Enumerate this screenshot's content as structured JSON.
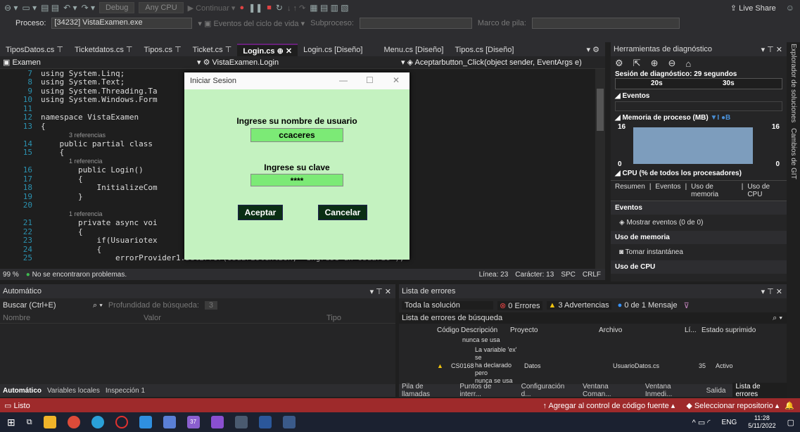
{
  "toolbar": {
    "debug": "Debug",
    "cpu": "Any CPU",
    "continue": "Continuar",
    "live_share": "Live Share"
  },
  "procbar": {
    "label": "Proceso:",
    "process": "[34232] VistaExamen.exe",
    "events": "Eventos del ciclo de vida",
    "subprocess": "Subproceso:",
    "frame": "Marco de pila:"
  },
  "tabs": [
    "TiposDatos.cs",
    "Ticketdatos.cs",
    "Tipos.cs",
    "Ticket.cs",
    "Login.cs",
    "Login.cs [Diseño]",
    "Menu.cs [Diseño]",
    "Tipos.cs [Diseño]"
  ],
  "active_tab": "Login.cs",
  "nav": {
    "project": "Examen",
    "class": "VistaExamen.Login",
    "member": "Aceptarbutton_Click(object sender, EventArgs e)"
  },
  "code": [
    {
      "n": "7",
      "t": "using System.Linq;"
    },
    {
      "n": "8",
      "t": "using System.Text;"
    },
    {
      "n": "9",
      "t": "using System.Threading.Ta"
    },
    {
      "n": "10",
      "t": "using System.Windows.Form"
    },
    {
      "n": "11",
      "t": ""
    },
    {
      "n": "12",
      "t": "namespace VistaExamen"
    },
    {
      "n": "13",
      "t": "{"
    },
    {
      "n": "",
      "t": "3 referencias",
      "ref": true
    },
    {
      "n": "14",
      "t": "    public partial class"
    },
    {
      "n": "15",
      "t": "    {"
    },
    {
      "n": "",
      "t": "1 referencia",
      "ref": true
    },
    {
      "n": "16",
      "t": "        public Login()"
    },
    {
      "n": "17",
      "t": "        {"
    },
    {
      "n": "18",
      "t": "            InitializeCom"
    },
    {
      "n": "19",
      "t": "        }"
    },
    {
      "n": "20",
      "t": ""
    },
    {
      "n": "",
      "t": "1 referencia",
      "ref": true
    },
    {
      "n": "21",
      "t": "        private async voi"
    },
    {
      "n": "22",
      "t": "        {"
    },
    {
      "n": "23",
      "t": "            if(Usuariotex"
    },
    {
      "n": "24",
      "t": "            {"
    },
    {
      "n": "25",
      "t": "                errorProvider1.SetError(UsuariotextBox, \"Ingrese un Usuario\");"
    }
  ],
  "editor_status": {
    "zoom": "99 %",
    "problems": "No se encontraron problemas.",
    "line": "Línea: 23",
    "char": "Carácter: 13",
    "mode": "SPC",
    "eol": "CRLF"
  },
  "dialog": {
    "title": "Iniciar Sesion",
    "user_label": "Ingrese su nombre de usuario",
    "user_value": "ccaceres",
    "pass_label": "Ingrese su clave",
    "pass_value": "****",
    "accept": "Aceptar",
    "cancel": "Cancelar"
  },
  "diag": {
    "title": "Herramientas de diagnóstico",
    "session": "Sesión de diagnóstico: 29 segundos",
    "t20": "20s",
    "t30": "30s",
    "events": "Eventos",
    "memory": "Memoria de proceso (MB)",
    "mem_left_top": "16",
    "mem_right_top": "16",
    "mem_left_bot": "0",
    "mem_right_bot": "0",
    "cpu": "CPU (% de todos los procesadores)",
    "tabs": [
      "Resumen",
      "Eventos",
      "Uso de memoria",
      "Uso de CPU"
    ],
    "sec_events": "Eventos",
    "show_events": "Mostrar eventos (0 de 0)",
    "sec_mem": "Uso de memoria",
    "snapshot": "Tomar instantánea",
    "sec_cpu": "Uso de CPU"
  },
  "side_vtabs": [
    "Explorador de soluciones",
    "Cambios de GIT"
  ],
  "auto": {
    "title": "Automático",
    "search": "Buscar (Ctrl+E)",
    "depth": "Profundidad de búsqueda:",
    "depth_val": "3",
    "col_name": "Nombre",
    "col_value": "Valor",
    "col_type": "Tipo",
    "tabs": [
      "Automático",
      "Variables locales",
      "Inspección 1"
    ]
  },
  "errors": {
    "title": "Lista de errores",
    "scope": "Toda la solución",
    "errors": "0 Errores",
    "warnings": "3 Advertencias",
    "messages": "0 de 1 Mensaje",
    "search": "Lista de errores de búsqueda",
    "cols": [
      "Código",
      "Descripción",
      "Proyecto",
      "Archivo",
      "Lí...",
      "Estado suprimido"
    ],
    "row0_desc": "nunca se usa",
    "row1": {
      "code": "CS0168",
      "desc1": "La variable 'ex' se",
      "desc2": "ha declarado pero",
      "desc3": "nunca se usa",
      "project": "Datos",
      "file": "UsuarioDatos.cs",
      "line": "35",
      "state": "Activo"
    },
    "tabs": [
      "Pila de llamadas",
      "Puntos de interr...",
      "Configuración d...",
      "Ventana Coman...",
      "Ventana Inmedi...",
      "Salida",
      "Lista de errores"
    ]
  },
  "status": {
    "ready": "Listo",
    "add_source": "Agregar al control de código fuente",
    "repo": "Seleccionar repositorio"
  },
  "taskbar": {
    "lang": "ENG",
    "time": "11:28",
    "date": "5/11/2022",
    "badge": "37"
  }
}
